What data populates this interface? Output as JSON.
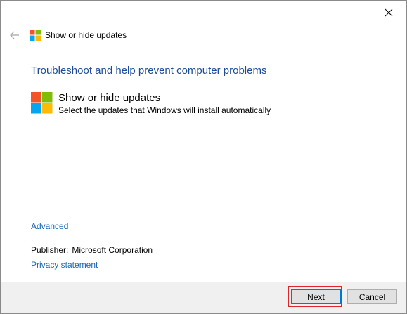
{
  "window": {
    "title": "Show or hide updates"
  },
  "content": {
    "heading": "Troubleshoot and help prevent computer problems",
    "item": {
      "title": "Show or hide updates",
      "description": "Select the updates that Windows will install automatically"
    },
    "advanced_link": "Advanced",
    "publisher_label": "Publisher:",
    "publisher_value": "Microsoft Corporation",
    "privacy_link": "Privacy statement"
  },
  "footer": {
    "next_label": "Next",
    "cancel_label": "Cancel"
  },
  "colors": {
    "heading": "#1e4b9a",
    "link": "#1a66b7",
    "highlight": "#e0242b",
    "logo_red": "#f35325",
    "logo_green": "#81bc06",
    "logo_blue": "#05a6f0",
    "logo_yellow": "#ffba08"
  }
}
